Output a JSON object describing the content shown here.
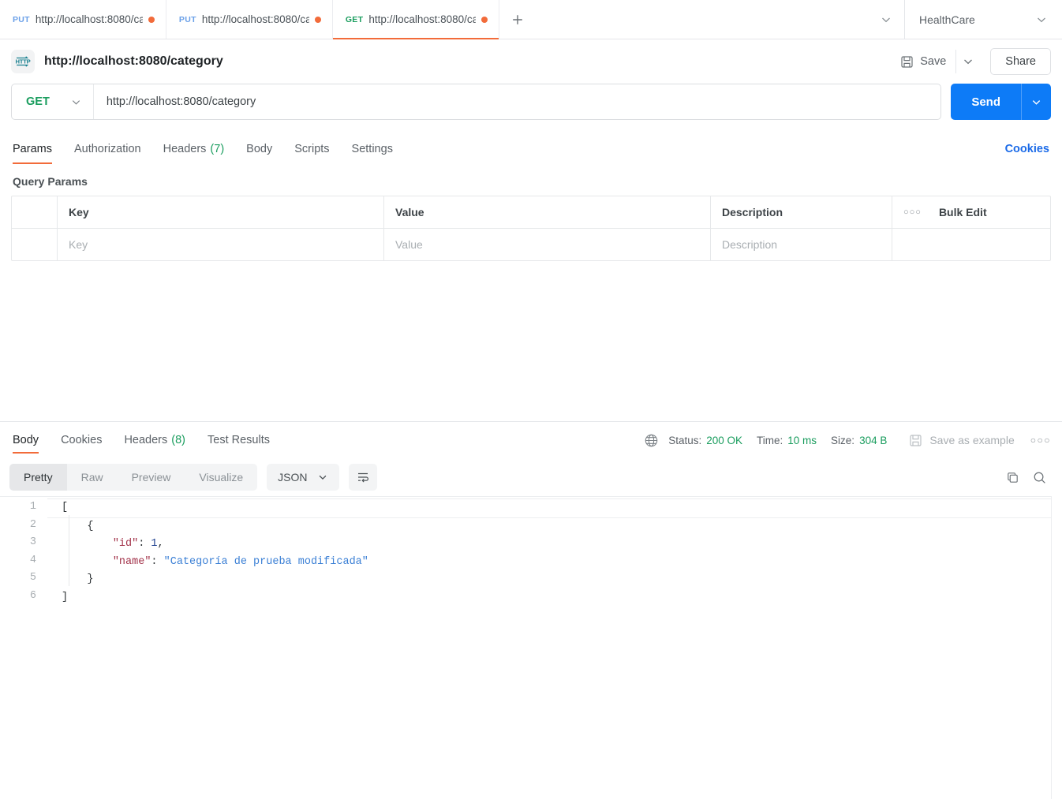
{
  "tabbar": {
    "tabs": [
      {
        "method": "PUT",
        "method_class": "put",
        "label": "http://localhost:8080/ca",
        "unsaved": true,
        "active": false
      },
      {
        "method": "PUT",
        "method_class": "put",
        "label": "http://localhost:8080/ca",
        "unsaved": true,
        "active": false
      },
      {
        "method": "GET",
        "method_class": "get",
        "label": "http://localhost:8080/ca",
        "unsaved": true,
        "active": true
      }
    ],
    "add_label": "+",
    "workspace": "HealthCare"
  },
  "request_header": {
    "protocol_badge": "HTTP",
    "title": "http://localhost:8080/category",
    "save_label": "Save",
    "share_label": "Share"
  },
  "url_bar": {
    "method": "GET",
    "url": "http://localhost:8080/category",
    "send_label": "Send"
  },
  "request_tabs": {
    "items": [
      {
        "label": "Params",
        "count": "",
        "active": true
      },
      {
        "label": "Authorization",
        "count": "",
        "active": false
      },
      {
        "label": "Headers",
        "count": "(7)",
        "active": false
      },
      {
        "label": "Body",
        "count": "",
        "active": false
      },
      {
        "label": "Scripts",
        "count": "",
        "active": false
      },
      {
        "label": "Settings",
        "count": "",
        "active": false
      }
    ],
    "cookies_link": "Cookies"
  },
  "query_params": {
    "section_title": "Query Params",
    "columns": {
      "key": "Key",
      "value": "Value",
      "description": "Description"
    },
    "bulk_edit_label": "Bulk Edit",
    "rows": [
      {
        "key_placeholder": "Key",
        "value_placeholder": "Value",
        "description_placeholder": "Description"
      }
    ]
  },
  "response": {
    "tabs": [
      {
        "label": "Body",
        "count": "",
        "active": true
      },
      {
        "label": "Cookies",
        "count": "",
        "active": false
      },
      {
        "label": "Headers",
        "count": "(8)",
        "active": false
      },
      {
        "label": "Test Results",
        "count": "",
        "active": false
      }
    ],
    "status_label": "Status:",
    "status_value": "200 OK",
    "time_label": "Time:",
    "time_value": "10 ms",
    "size_label": "Size:",
    "size_value": "304 B",
    "save_example_label": "Save as example",
    "format_tabs": [
      {
        "label": "Pretty",
        "active": true
      },
      {
        "label": "Raw",
        "active": false
      },
      {
        "label": "Preview",
        "active": false
      },
      {
        "label": "Visualize",
        "active": false
      }
    ],
    "language": "JSON",
    "body_lines": [
      {
        "n": "1",
        "active": true,
        "tokens": [
          {
            "t": "[",
            "c": "tk-punct"
          }
        ]
      },
      {
        "n": "2",
        "active": false,
        "tokens": [
          {
            "t": "    {",
            "c": "tk-punct"
          }
        ]
      },
      {
        "n": "3",
        "active": false,
        "tokens": [
          {
            "t": "        ",
            "c": "tk-punct"
          },
          {
            "t": "\"id\"",
            "c": "tk-key"
          },
          {
            "t": ": ",
            "c": "tk-punct"
          },
          {
            "t": "1",
            "c": "tk-num"
          },
          {
            "t": ",",
            "c": "tk-punct"
          }
        ]
      },
      {
        "n": "4",
        "active": false,
        "tokens": [
          {
            "t": "        ",
            "c": "tk-punct"
          },
          {
            "t": "\"name\"",
            "c": "tk-key"
          },
          {
            "t": ": ",
            "c": "tk-punct"
          },
          {
            "t": "\"Categoría de prueba modificada\"",
            "c": "tk-str"
          }
        ]
      },
      {
        "n": "5",
        "active": false,
        "tokens": [
          {
            "t": "    }",
            "c": "tk-punct"
          }
        ]
      },
      {
        "n": "6",
        "active": false,
        "tokens": [
          {
            "t": "]",
            "c": "tk-punct"
          }
        ]
      }
    ]
  },
  "colors": {
    "accent_orange": "#f26b3a",
    "send_blue": "#0d7bf7",
    "link_blue": "#1a6ae8",
    "success_green": "#1a9d5e",
    "json_key": "#a3344b",
    "json_string": "#3a7fd5",
    "json_number": "#1d3f8f"
  }
}
